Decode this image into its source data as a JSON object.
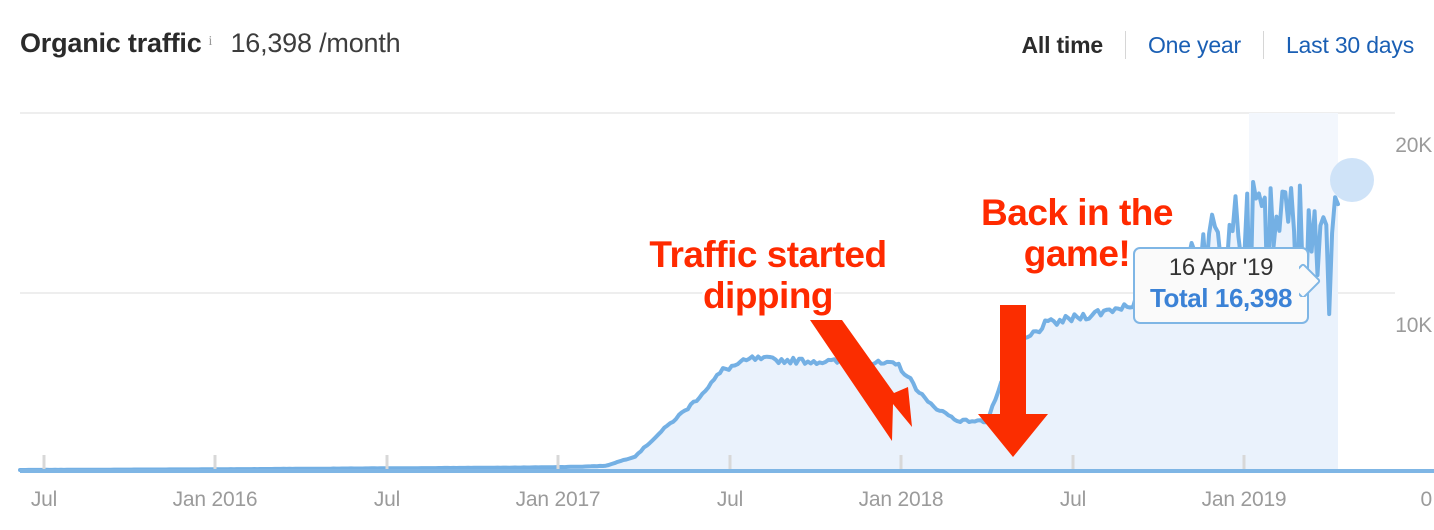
{
  "header": {
    "metric_title": "Organic traffic",
    "info_icon": "info-icon",
    "metric_value": "16,398 /month",
    "ranges": [
      {
        "label": "All time",
        "active": true
      },
      {
        "label": "One year",
        "active": false
      },
      {
        "label": "Last 30 days",
        "active": false
      }
    ]
  },
  "tooltip": {
    "date": "16 Apr '19",
    "total": "Total 16,398"
  },
  "annotations": [
    {
      "id": "traffic-dipping",
      "line1": "Traffic started",
      "line2": "dipping"
    },
    {
      "id": "back-in-game",
      "line1": "Back in the",
      "line2": "game!"
    }
  ],
  "colors": {
    "line": "#74b0e4",
    "area": "#eaf2fc",
    "annotation_red": "#ff2a00",
    "link_blue": "#1a5fb4",
    "tooltip_blue": "#3b82d6",
    "gridline": "#eeeeee",
    "axis_text": "#9b9b9b"
  },
  "chart_data": {
    "type": "area",
    "title": "Organic traffic",
    "xlabel": "",
    "ylabel": "",
    "ylim": [
      0,
      22000
    ],
    "grid": true,
    "legend": null,
    "ytick_labels": [
      "20K",
      "10K",
      "0"
    ],
    "ytick_values": [
      20000,
      10000,
      0
    ],
    "xtick_labels": [
      "Jul",
      "Jan 2016",
      "Jul",
      "Jan 2017",
      "Jul",
      "Jan 2018",
      "Jul",
      "Jan 2019"
    ],
    "highlight_point": {
      "x": "16 Apr '19",
      "y": 16398
    },
    "series": [
      {
        "name": "Organic traffic",
        "x": [
          "2015-07",
          "2015-08",
          "2015-09",
          "2015-10",
          "2015-11",
          "2015-12",
          "2016-01",
          "2016-02",
          "2016-03",
          "2016-04",
          "2016-05",
          "2016-06",
          "2016-07",
          "2016-08",
          "2016-09",
          "2016-10",
          "2016-11",
          "2016-12",
          "2017-01",
          "2017-02",
          "2017-03",
          "2017-04",
          "2017-05",
          "2017-06",
          "2017-07",
          "2017-08",
          "2017-09",
          "2017-10",
          "2017-11",
          "2017-12",
          "2018-01",
          "2018-02",
          "2018-03",
          "2018-04",
          "2018-05",
          "2018-06",
          "2018-07",
          "2018-08",
          "2018-09",
          "2018-10",
          "2018-11",
          "2018-12",
          "2019-01",
          "2019-02",
          "2019-03",
          "2019-04"
        ],
        "values": [
          60,
          70,
          75,
          80,
          90,
          95,
          100,
          110,
          120,
          130,
          140,
          150,
          160,
          170,
          180,
          190,
          200,
          210,
          230,
          260,
          320,
          900,
          2600,
          4200,
          6200,
          6900,
          6800,
          6750,
          6700,
          6650,
          6500,
          4200,
          3100,
          3050,
          7600,
          9000,
          9400,
          9800,
          10300,
          12200,
          13600,
          14500,
          15600,
          15300,
          15800,
          16398
        ]
      }
    ]
  }
}
